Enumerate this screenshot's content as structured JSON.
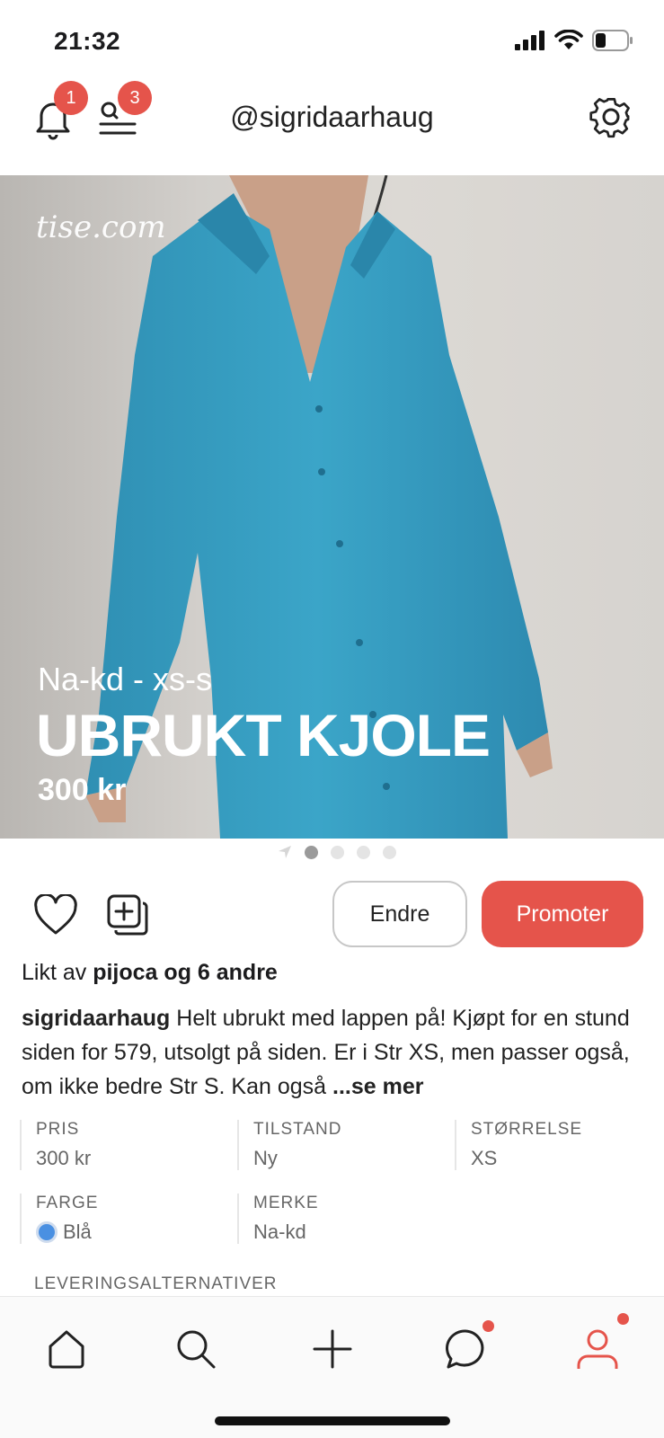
{
  "status_bar": {
    "time": "21:32"
  },
  "header": {
    "username": "@sigridaarhaug",
    "notification_count": "1",
    "menu_count": "3",
    "icons": {
      "notifications": "bell-icon",
      "menu": "search-list-icon",
      "settings": "gear-icon"
    }
  },
  "photo": {
    "watermark": "tise.com",
    "overlay_sub": "Na-kd - xs-s",
    "overlay_title": "UBRUKT KJOLE",
    "overlay_price": "300 kr",
    "page_count": 4,
    "active_page": 1
  },
  "actions": {
    "edit_label": "Endre",
    "promote_label": "Promoter",
    "icons": {
      "like": "heart-icon",
      "collection": "add-to-collection-icon"
    }
  },
  "likes": {
    "prefix": "Likt av",
    "user": "pijoca",
    "suffix": "og 6 andre"
  },
  "description": {
    "author": "sigridaarhaug",
    "text": "Helt ubrukt med lappen på! Kjøpt for en stund siden for 579, utsolgt på siden. Er i Str XS, men passer også, om ikke bedre Str S. Kan også",
    "more": "...se mer"
  },
  "details": {
    "price": {
      "label": "PRIS",
      "value": "300 kr"
    },
    "condition": {
      "label": "TILSTAND",
      "value": "Ny"
    },
    "size": {
      "label": "STØRRELSE",
      "value": "XS"
    },
    "color": {
      "label": "FARGE",
      "value": "Blå",
      "swatch": "#4a90e2"
    },
    "brand": {
      "label": "MERKE",
      "value": "Na-kd"
    },
    "delivery": {
      "label": "LEVERINGSALTERNATIVER"
    }
  },
  "tabbar": {
    "tabs": [
      "home-icon",
      "search-icon",
      "plus-icon",
      "chat-icon",
      "profile-icon"
    ],
    "accent": "#e5544b"
  }
}
